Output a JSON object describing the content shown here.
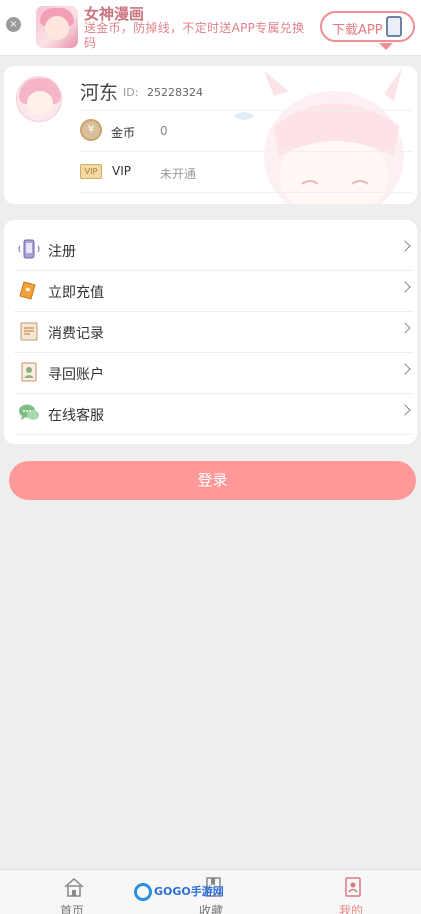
{
  "banner": {
    "app_name": "女神漫画",
    "description": "送金币，防掉线，不定时送APP专属兑换码",
    "download_label": "下载APP"
  },
  "profile": {
    "nickname": "河东",
    "id_label": "ID:",
    "id_value": "25228324",
    "coin_label": "金币",
    "coin_value": "0",
    "vip_label": "VIP",
    "vip_status": "未开通"
  },
  "menu": {
    "items": [
      {
        "label": "注册",
        "icon": "register-phone-icon"
      },
      {
        "label": "立即充值",
        "icon": "recharge-ticket-icon"
      },
      {
        "label": "消费记录",
        "icon": "record-icon"
      },
      {
        "label": "寻回账户",
        "icon": "recover-account-icon"
      },
      {
        "label": "在线客服",
        "icon": "chat-service-icon"
      }
    ]
  },
  "login_label": "登录",
  "tabbar": {
    "items": [
      {
        "label": "首页",
        "icon": "home-icon"
      },
      {
        "label": "收藏",
        "icon": "bookmark-icon"
      },
      {
        "label": "我的",
        "icon": "profile-book-icon"
      }
    ],
    "active": "我的"
  },
  "watermark": "GOGO手游网",
  "colors": {
    "accent": "#ff9999",
    "banner_text": "#e0808a",
    "background": "#eeeeee"
  }
}
